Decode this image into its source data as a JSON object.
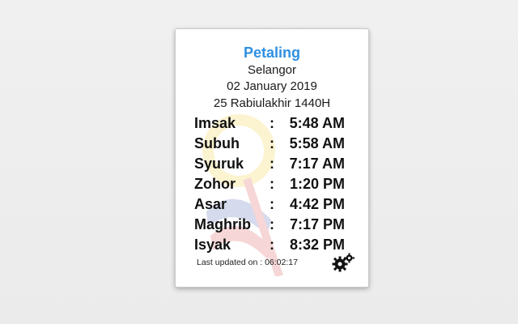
{
  "location": {
    "district": "Petaling",
    "state": "Selangor",
    "date": "02 January 2019",
    "hijri_date": "25 Rabiulakhir 1440H"
  },
  "prayer_times": [
    {
      "name": "Imsak",
      "time": "5:48 AM"
    },
    {
      "name": "Subuh",
      "time": "5:58 AM"
    },
    {
      "name": "Syuruk",
      "time": "7:17 AM"
    },
    {
      "name": "Zohor",
      "time": "1:20 PM"
    },
    {
      "name": "Asar",
      "time": "4:42 PM"
    },
    {
      "name": "Maghrib",
      "time": "7:17 PM"
    },
    {
      "name": "Isyak",
      "time": "8:32 PM"
    }
  ],
  "separator": ":",
  "footer": {
    "last_updated": "Last updated on : 06:02:17",
    "settings_icon": "gears-icon"
  },
  "colors": {
    "accent": "#2e8fe0",
    "text": "#111111"
  }
}
